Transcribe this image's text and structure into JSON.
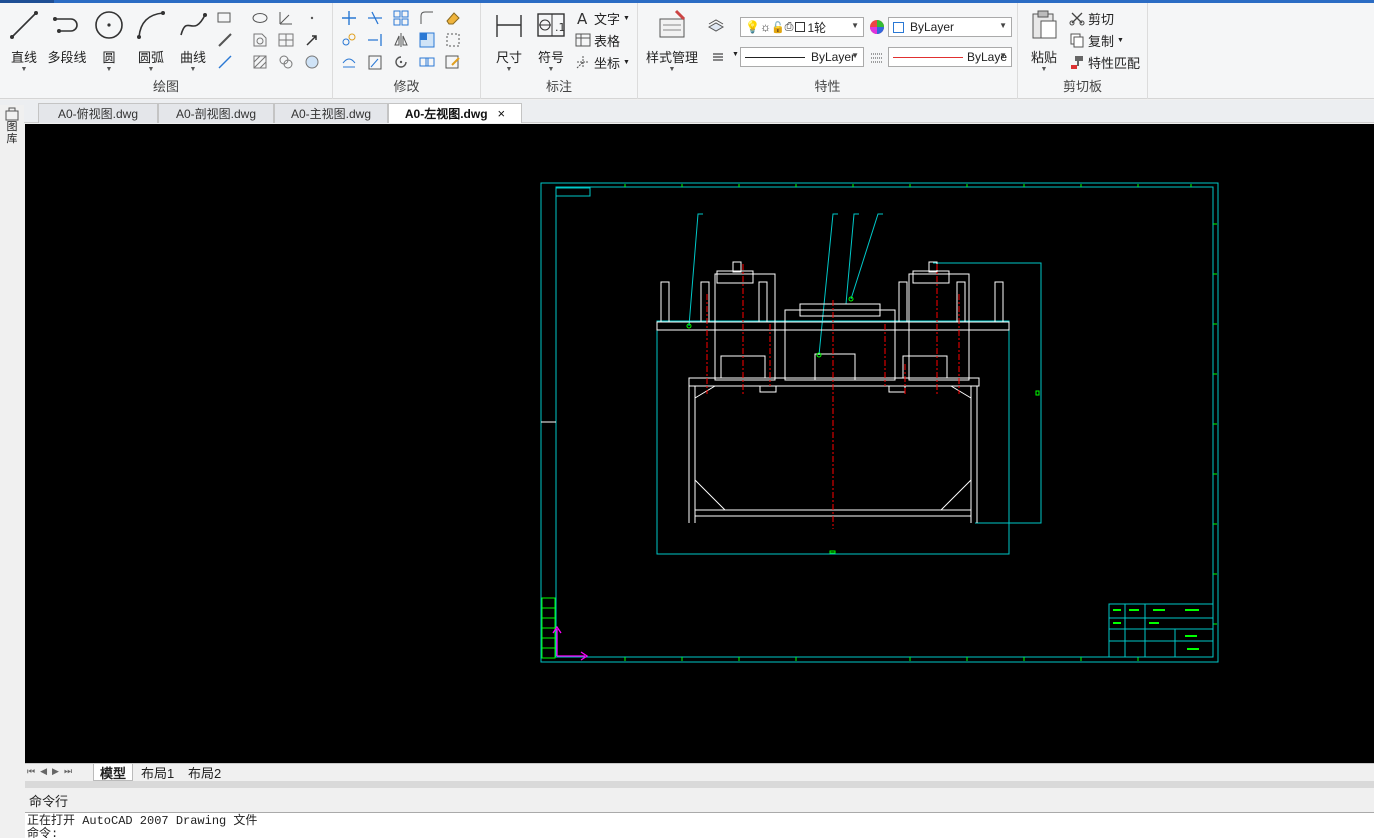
{
  "ribbon": {
    "draw": {
      "title": "绘图",
      "line": "直线",
      "polyline": "多段线",
      "circle": "圆",
      "arc": "圆弧",
      "spline": "曲线"
    },
    "modify": {
      "title": "修改"
    },
    "annotation": {
      "title": "标注",
      "dimension": "尺寸",
      "symbol": "符号",
      "text": "文字",
      "table": "表格",
      "coordinate": "坐标"
    },
    "properties": {
      "title": "特性",
      "style_manager": "样式管理",
      "layer_value": "1轮",
      "color_value": "ByLayer",
      "linetype_value": "ByLayer",
      "lineweight_value": "ByLaye"
    },
    "clipboard": {
      "title": "剪切板",
      "paste": "粘贴",
      "cut": "剪切",
      "copy": "复制",
      "match_properties": "特性匹配"
    }
  },
  "doc_tabs": [
    {
      "label": "A0-俯视图.dwg"
    },
    {
      "label": "A0-剖视图.dwg"
    },
    {
      "label": "A0-主视图.dwg"
    },
    {
      "label": "A0-左视图.dwg"
    }
  ],
  "left_strip_label": "图库",
  "layout_tabs": [
    "模型",
    "布局1",
    "布局2"
  ],
  "command": {
    "bar_label": "命令行",
    "history": [
      "正在打开 AutoCAD 2007 Drawing 文件",
      "命令:"
    ]
  },
  "colors": {
    "canvas": "#000000",
    "frame": "#00c8c8",
    "drawing": "#ffffff",
    "center": "#ff0000",
    "annotation": "#00ff00",
    "ucs": "#ff00ff"
  }
}
